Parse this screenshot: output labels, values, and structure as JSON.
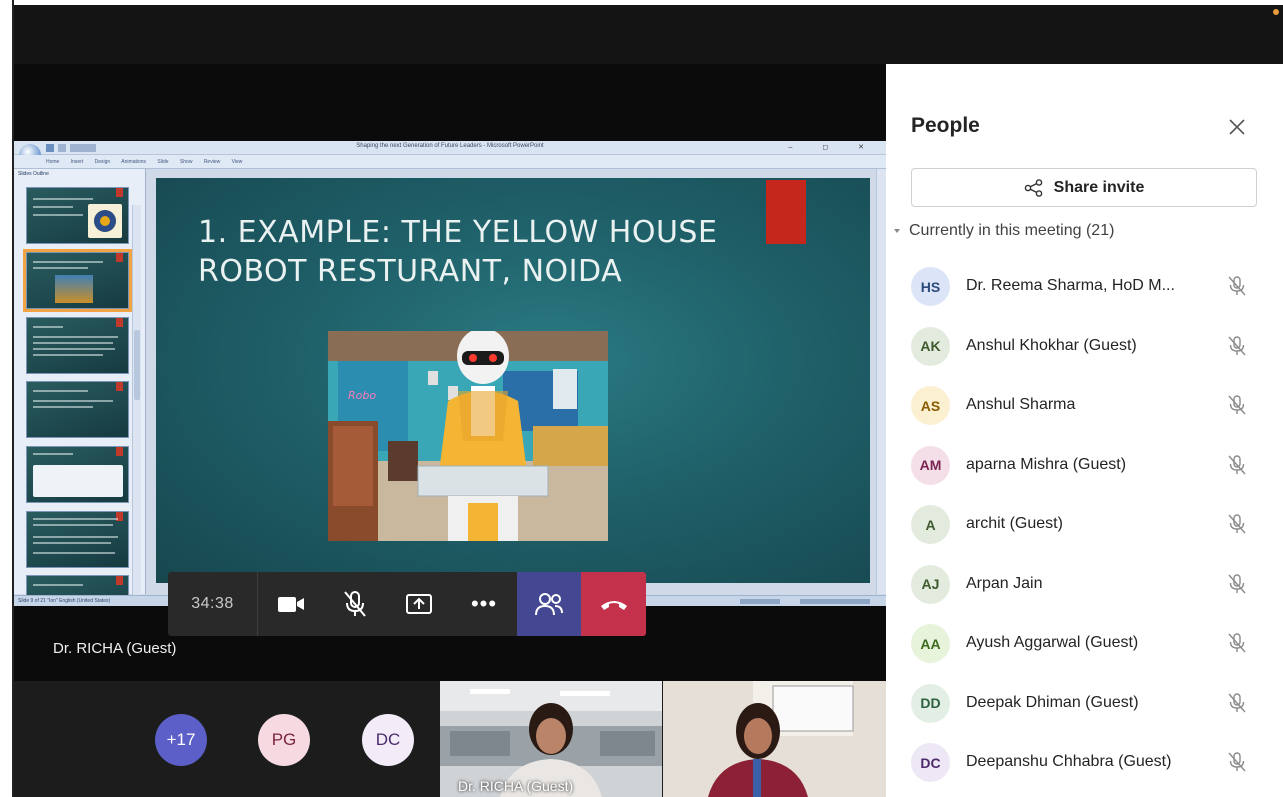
{
  "powerpoint": {
    "window_title": "Shaping the next Generation of Future Leaders - Microsoft PowerPoint",
    "ribbon_tabs": "Home Insert Design Animations Slide Show Review View",
    "pane_tabs": "Slides   Outline",
    "status_text": "Slide 9 of 21   \"Ion\"   English (United States)",
    "slide": {
      "title_line1": "1. EXAMPLE: THE YELLOW HOUSE",
      "title_line2": "ROBOT RESTURANT, NOIDA",
      "photo": "robot-waiter-photo"
    }
  },
  "call": {
    "timer": "34:38",
    "speaker_name": "Dr. RICHA (Guest)",
    "controls": [
      "camera",
      "mic-off",
      "share-tray",
      "more",
      "people",
      "hang-up"
    ]
  },
  "gallery": {
    "overflow": "+17",
    "avatars": [
      "PG",
      "DC"
    ],
    "tile_name": "Dr. RICHA (Guest)"
  },
  "people_panel": {
    "title": "People",
    "share_invite": "Share invite",
    "section_label": "Currently in this meeting (21)",
    "participants": [
      {
        "initials": "HS",
        "name": "Dr. Reema Sharma, HoD M...",
        "bg": "#dbe5f7",
        "fg": "#2c4a7a"
      },
      {
        "initials": "AK",
        "name": "Anshul Khokhar (Guest)",
        "bg": "#e3ebdf",
        "fg": "#3f5a2e"
      },
      {
        "initials": "AS",
        "name": "Anshul Sharma",
        "bg": "#fbf0cf",
        "fg": "#8a5a00"
      },
      {
        "initials": "AM",
        "name": "aparna Mishra (Guest)",
        "bg": "#f4dfe9",
        "fg": "#7a2552"
      },
      {
        "initials": "A",
        "name": "archit (Guest)",
        "bg": "#e3ebdf",
        "fg": "#3f5a2e"
      },
      {
        "initials": "AJ",
        "name": "Arpan Jain",
        "bg": "#e3ebdf",
        "fg": "#3f5a2e"
      },
      {
        "initials": "AA",
        "name": "Ayush Aggarwal (Guest)",
        "bg": "#e8f3dc",
        "fg": "#3f6b1f"
      },
      {
        "initials": "DD",
        "name": "Deepak Dhiman (Guest)",
        "bg": "#e3efe4",
        "fg": "#2d6040"
      },
      {
        "initials": "DC",
        "name": "Deepanshu Chhabra (Guest)",
        "bg": "#ede7f6",
        "fg": "#4c2c6b"
      }
    ]
  }
}
